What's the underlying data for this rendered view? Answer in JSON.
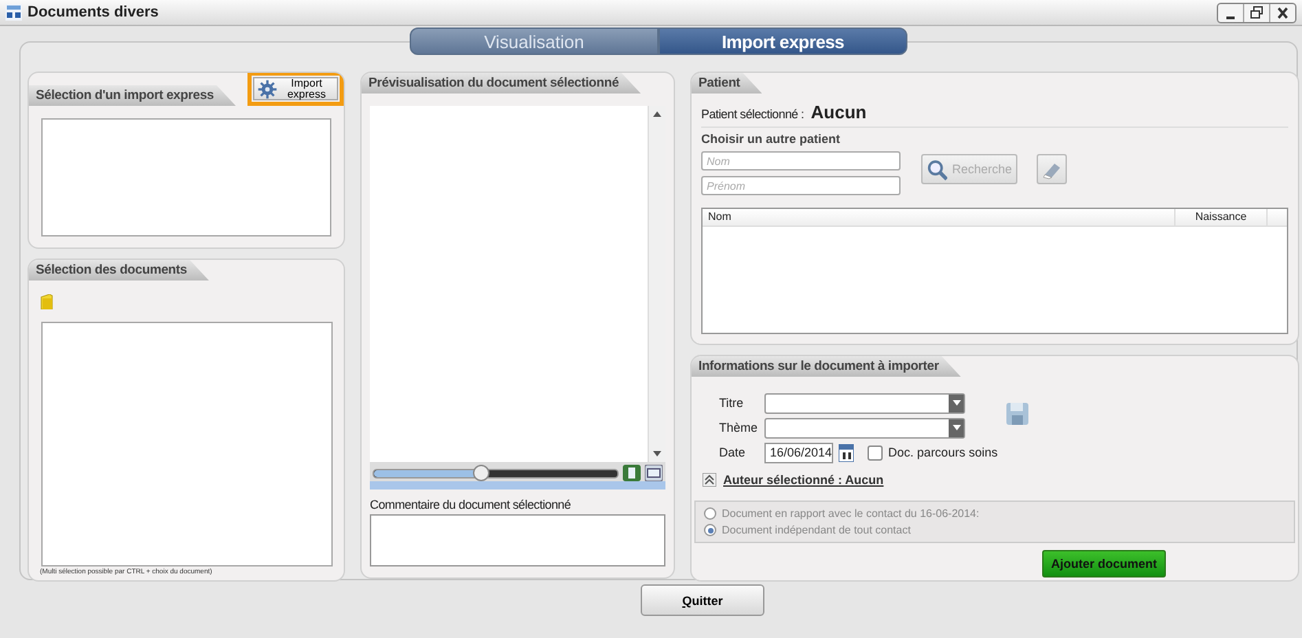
{
  "window": {
    "title": "Documents divers"
  },
  "tabs": [
    {
      "label": "Visualisation",
      "selected": false
    },
    {
      "label": "Import express",
      "selected": true
    }
  ],
  "import_panel": {
    "title": "Sélection d'un import express",
    "button": {
      "label": "Import express",
      "highlighted": true
    }
  },
  "documents_panel": {
    "title": "Sélection des documents",
    "hint": "(Multi sélection possible par CTRL + choix du document)"
  },
  "preview_panel": {
    "title": "Prévisualisation du document sélectionné",
    "zoom": {
      "level": 0.44
    },
    "comment_label": "Commentaire du document sélectionné"
  },
  "patient_panel": {
    "title": "Patient",
    "selected_label": "Patient sélectionné :",
    "selected_value": "Aucun",
    "search_title": "Choisir un autre patient",
    "name_placeholder": "Nom",
    "firstname_placeholder": "Prénom",
    "search_button": {
      "label": "Recherche",
      "disabled": true
    },
    "columns": [
      "Nom",
      "Naissance"
    ]
  },
  "document_panel": {
    "title": "Informations sur le document à importer",
    "fields": [
      {
        "label": "Titre",
        "kind": "select"
      },
      {
        "label": "Thème",
        "kind": "select"
      },
      {
        "label": "Date",
        "kind": "date",
        "value": "16/06/2014"
      }
    ],
    "care_path": {
      "label": "Doc. parcours soins",
      "checked": false
    },
    "author_link": "Auteur sélectionné : Aucun",
    "contact_group": {
      "disabled": true,
      "options": [
        {
          "label": "Document en rapport avec le contact du 16-06-2014:",
          "selected": false
        },
        {
          "label": "Document indépendant de tout contact",
          "selected": true
        }
      ]
    },
    "add_button": "Ajouter document"
  },
  "quit_button": "Quitter"
}
